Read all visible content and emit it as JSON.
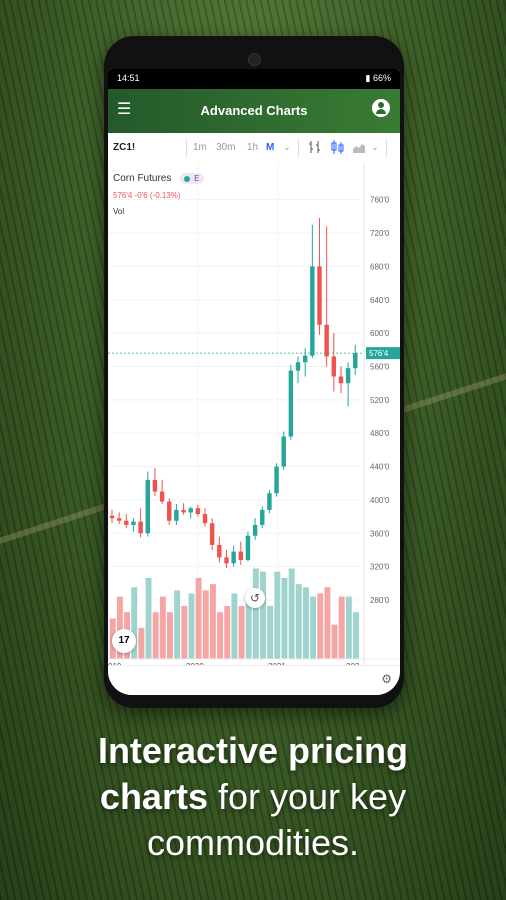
{
  "status": {
    "time": "14:51",
    "battery": "66%"
  },
  "appbar": {
    "title": "Advanced Charts",
    "menu_icon": "hamburger-menu-icon",
    "account_icon": "account-circle-icon"
  },
  "toolbar": {
    "symbol": "ZC1!",
    "intervals": [
      "1m",
      "30m",
      "1h",
      "M"
    ],
    "active_interval": "M"
  },
  "legend": {
    "name": "Corn Futures",
    "badge": "E",
    "last": "576'4  -0'6 (-0.13%)",
    "vol_label": "Vol"
  },
  "chart_data": {
    "type": "candlestick",
    "symbol": "ZC1!",
    "title": "Corn Futures",
    "interval": "M",
    "ylim": [
      250,
      780
    ],
    "y_ticks": [
      "760'0",
      "720'0",
      "680'0",
      "640'0",
      "600'0",
      "560'0",
      "520'0",
      "480'0",
      "440'0",
      "400'0",
      "360'0",
      "320'0",
      "280'0"
    ],
    "x_ticks": [
      "019",
      "2020",
      "2021",
      "202"
    ],
    "last_price_label": "576'4",
    "candles": [
      {
        "o": 381,
        "h": 388,
        "l": 372,
        "c": 378
      },
      {
        "o": 378,
        "h": 385,
        "l": 371,
        "c": 375
      },
      {
        "o": 375,
        "h": 383,
        "l": 366,
        "c": 370
      },
      {
        "o": 370,
        "h": 378,
        "l": 362,
        "c": 374
      },
      {
        "o": 374,
        "h": 390,
        "l": 355,
        "c": 360
      },
      {
        "o": 360,
        "h": 434,
        "l": 356,
        "c": 424
      },
      {
        "o": 424,
        "h": 438,
        "l": 405,
        "c": 410
      },
      {
        "o": 410,
        "h": 424,
        "l": 395,
        "c": 398
      },
      {
        "o": 398,
        "h": 402,
        "l": 370,
        "c": 375
      },
      {
        "o": 375,
        "h": 395,
        "l": 370,
        "c": 388
      },
      {
        "o": 388,
        "h": 396,
        "l": 382,
        "c": 385
      },
      {
        "o": 385,
        "h": 392,
        "l": 378,
        "c": 390
      },
      {
        "o": 390,
        "h": 394,
        "l": 380,
        "c": 383
      },
      {
        "o": 383,
        "h": 390,
        "l": 368,
        "c": 372
      },
      {
        "o": 372,
        "h": 378,
        "l": 340,
        "c": 346
      },
      {
        "o": 346,
        "h": 356,
        "l": 325,
        "c": 331
      },
      {
        "o": 331,
        "h": 340,
        "l": 318,
        "c": 324
      },
      {
        "o": 324,
        "h": 345,
        "l": 320,
        "c": 338
      },
      {
        "o": 338,
        "h": 350,
        "l": 322,
        "c": 328
      },
      {
        "o": 328,
        "h": 362,
        "l": 326,
        "c": 357
      },
      {
        "o": 357,
        "h": 378,
        "l": 352,
        "c": 370
      },
      {
        "o": 370,
        "h": 392,
        "l": 366,
        "c": 388
      },
      {
        "o": 388,
        "h": 412,
        "l": 384,
        "c": 408
      },
      {
        "o": 408,
        "h": 444,
        "l": 404,
        "c": 440
      },
      {
        "o": 440,
        "h": 482,
        "l": 436,
        "c": 476
      },
      {
        "o": 476,
        "h": 562,
        "l": 472,
        "c": 555
      },
      {
        "o": 555,
        "h": 572,
        "l": 540,
        "c": 565
      },
      {
        "o": 565,
        "h": 582,
        "l": 548,
        "c": 573
      },
      {
        "o": 573,
        "h": 730,
        "l": 570,
        "c": 680
      },
      {
        "o": 680,
        "h": 738,
        "l": 598,
        "c": 610
      },
      {
        "o": 610,
        "h": 728,
        "l": 560,
        "c": 572
      },
      {
        "o": 572,
        "h": 600,
        "l": 530,
        "c": 548
      },
      {
        "o": 548,
        "h": 560,
        "l": 528,
        "c": 540
      },
      {
        "o": 540,
        "h": 565,
        "l": 512,
        "c": 558
      },
      {
        "o": 558,
        "h": 586,
        "l": 550,
        "c": 576
      }
    ],
    "volume": [
      26,
      40,
      30,
      46,
      20,
      52,
      30,
      40,
      30,
      44,
      34,
      42,
      52,
      44,
      48,
      30,
      34,
      42,
      34,
      42,
      58,
      56,
      34,
      56,
      52,
      58,
      48,
      46,
      40,
      42,
      46,
      22,
      40,
      40,
      30
    ]
  },
  "caption": {
    "bold": "Interactive pricing",
    "bold2": "charts",
    "rest": "for your key",
    "line3": "commodities."
  },
  "colors": {
    "up": "#26a69a",
    "down": "#ef5350",
    "up_vol": "#9fd3cd",
    "down_vol": "#f4a5a4",
    "appbar": "#2d6a2f"
  }
}
